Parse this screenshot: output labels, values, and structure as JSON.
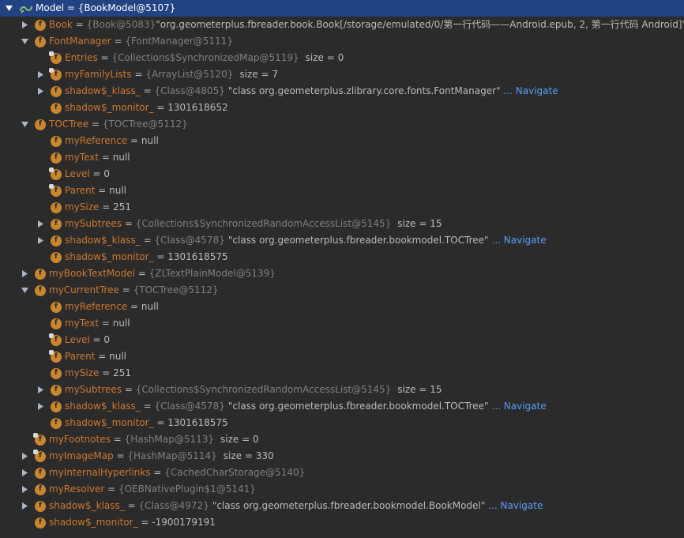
{
  "tree": [
    {
      "depth": 0,
      "arrow": "down",
      "icon": "object",
      "name": "Model",
      "eq": " = ",
      "type": "{BookModel@5107}",
      "selected": true
    },
    {
      "depth": 1,
      "arrow": "right",
      "icon": "field",
      "locked": false,
      "name": "Book",
      "eq": " = ",
      "type": "{Book@5083}",
      "str": "\"org.geometerplus.fbreader.book.Book[/storage/emulated/0/第一行代码——Android.epub, 2, 第一行代码 Android]\""
    },
    {
      "depth": 1,
      "arrow": "down",
      "icon": "field",
      "locked": false,
      "name": "FontManager",
      "eq": " = ",
      "type": "{FontManager@5111}"
    },
    {
      "depth": 2,
      "arrow": "none",
      "icon": "field",
      "locked": true,
      "name": "Entries",
      "eq": " = ",
      "type": "{Collections$SynchronizedMap@5119}",
      "size": "size = 0"
    },
    {
      "depth": 2,
      "arrow": "right",
      "icon": "field",
      "locked": true,
      "name": "myFamilyLists",
      "eq": " = ",
      "type": "{ArrayList@5120}",
      "size": "size = 7"
    },
    {
      "depth": 2,
      "arrow": "right",
      "icon": "field",
      "locked": false,
      "name": "shadow$_klass_",
      "eq": " = ",
      "type": "{Class@4805}",
      "str": "\"class org.geometerplus.zlibrary.core.fonts.FontManager\"",
      "nav": "... Navigate"
    },
    {
      "depth": 2,
      "arrow": "none",
      "icon": "field",
      "locked": false,
      "name": "shadow$_monitor_",
      "eq": " = ",
      "value": "1301618652"
    },
    {
      "depth": 1,
      "arrow": "down",
      "icon": "field",
      "locked": false,
      "name": "TOCTree",
      "eq": " = ",
      "type": "{TOCTree@5112}"
    },
    {
      "depth": 2,
      "arrow": "none",
      "icon": "field",
      "locked": false,
      "name": "myReference",
      "eq": " = ",
      "value": "null"
    },
    {
      "depth": 2,
      "arrow": "none",
      "icon": "field",
      "locked": false,
      "name": "myText",
      "eq": " = ",
      "value": "null"
    },
    {
      "depth": 2,
      "arrow": "none",
      "icon": "field",
      "locked": true,
      "name": "Level",
      "eq": " = ",
      "value": "0"
    },
    {
      "depth": 2,
      "arrow": "none",
      "icon": "field",
      "locked": true,
      "name": "Parent",
      "eq": " = ",
      "value": "null"
    },
    {
      "depth": 2,
      "arrow": "none",
      "icon": "field",
      "locked": false,
      "name": "mySize",
      "eq": " = ",
      "value": "251"
    },
    {
      "depth": 2,
      "arrow": "right",
      "icon": "field",
      "locked": false,
      "name": "mySubtrees",
      "eq": " = ",
      "type": "{Collections$SynchronizedRandomAccessList@5145}",
      "size": "size = 15"
    },
    {
      "depth": 2,
      "arrow": "right",
      "icon": "field",
      "locked": false,
      "name": "shadow$_klass_",
      "eq": " = ",
      "type": "{Class@4578}",
      "str": "\"class org.geometerplus.fbreader.bookmodel.TOCTree\"",
      "nav": "... Navigate"
    },
    {
      "depth": 2,
      "arrow": "none",
      "icon": "field",
      "locked": false,
      "name": "shadow$_monitor_",
      "eq": " = ",
      "value": "1301618575"
    },
    {
      "depth": 1,
      "arrow": "right",
      "icon": "field",
      "locked": false,
      "name": "myBookTextModel",
      "eq": " = ",
      "type": "{ZLTextPlainModel@5139}"
    },
    {
      "depth": 1,
      "arrow": "down",
      "icon": "field",
      "locked": false,
      "name": "myCurrentTree",
      "eq": " = ",
      "type": "{TOCTree@5112}"
    },
    {
      "depth": 2,
      "arrow": "none",
      "icon": "field",
      "locked": false,
      "name": "myReference",
      "eq": " = ",
      "value": "null"
    },
    {
      "depth": 2,
      "arrow": "none",
      "icon": "field",
      "locked": false,
      "name": "myText",
      "eq": " = ",
      "value": "null"
    },
    {
      "depth": 2,
      "arrow": "none",
      "icon": "field",
      "locked": true,
      "name": "Level",
      "eq": " = ",
      "value": "0"
    },
    {
      "depth": 2,
      "arrow": "none",
      "icon": "field",
      "locked": true,
      "name": "Parent",
      "eq": " = ",
      "value": "null"
    },
    {
      "depth": 2,
      "arrow": "none",
      "icon": "field",
      "locked": false,
      "name": "mySize",
      "eq": " = ",
      "value": "251"
    },
    {
      "depth": 2,
      "arrow": "right",
      "icon": "field",
      "locked": false,
      "name": "mySubtrees",
      "eq": " = ",
      "type": "{Collections$SynchronizedRandomAccessList@5145}",
      "size": "size = 15"
    },
    {
      "depth": 2,
      "arrow": "right",
      "icon": "field",
      "locked": false,
      "name": "shadow$_klass_",
      "eq": " = ",
      "type": "{Class@4578}",
      "str": "\"class org.geometerplus.fbreader.bookmodel.TOCTree\"",
      "nav": "... Navigate"
    },
    {
      "depth": 2,
      "arrow": "none",
      "icon": "field",
      "locked": false,
      "name": "shadow$_monitor_",
      "eq": " = ",
      "value": "1301618575"
    },
    {
      "depth": 1,
      "arrow": "none",
      "icon": "field",
      "locked": true,
      "name": "myFootnotes",
      "eq": " = ",
      "type": "{HashMap@5113}",
      "size": "size = 0"
    },
    {
      "depth": 1,
      "arrow": "right",
      "icon": "field",
      "locked": true,
      "name": "myImageMap",
      "eq": " = ",
      "type": "{HashMap@5114}",
      "size": "size = 330"
    },
    {
      "depth": 1,
      "arrow": "right",
      "icon": "field",
      "locked": false,
      "name": "myInternalHyperlinks",
      "eq": " = ",
      "type": "{CachedCharStorage@5140}"
    },
    {
      "depth": 1,
      "arrow": "right",
      "icon": "field",
      "locked": false,
      "name": "myResolver",
      "eq": " = ",
      "type": "{OEBNativePlugin$1@5141}"
    },
    {
      "depth": 1,
      "arrow": "right",
      "icon": "field",
      "locked": false,
      "name": "shadow$_klass_",
      "eq": " = ",
      "type": "{Class@4972}",
      "str": "\"class org.geometerplus.fbreader.bookmodel.BookModel\"",
      "nav": "... Navigate"
    },
    {
      "depth": 1,
      "arrow": "none",
      "icon": "field",
      "locked": false,
      "name": "shadow$_monitor_",
      "eq": " = ",
      "value": "-1900179191"
    }
  ],
  "colors": {
    "background": "#2b2b2b",
    "selected_row": "#214283",
    "field_name": "#cc7832",
    "type_text": "#808080",
    "navigate_link": "#589df6",
    "field_icon": "#c9862f"
  },
  "icons": {
    "field": "f-field-icon",
    "object": "infinity-object-icon",
    "expand": "chevron-right-icon",
    "collapse": "chevron-down-icon"
  }
}
